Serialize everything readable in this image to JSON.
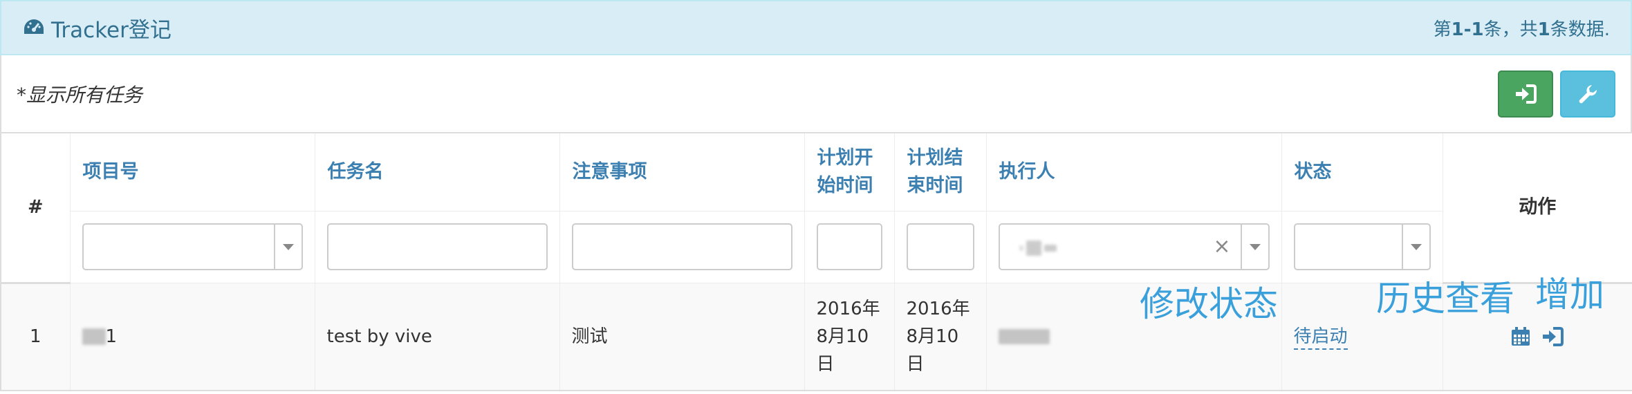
{
  "header": {
    "title": "Tracker登记",
    "summary_prefix": "第",
    "summary_range": "1-1",
    "summary_mid": "条，共",
    "summary_total": "1",
    "summary_suffix": "条数据."
  },
  "toolbar": {
    "filter_text": "*显示所有任务"
  },
  "table": {
    "columns": [
      "#",
      "项目号",
      "任务名",
      "注意事项",
      "计划开始时间",
      "计划结束时间",
      "执行人",
      "状态",
      "动作"
    ],
    "rows": [
      {
        "index": "1",
        "project_suffix": "1",
        "task_name": "test by vive",
        "notes": "测试",
        "plan_start": "2016年8月10日",
        "plan_end": "2016年8月10日",
        "status": "待启动"
      }
    ]
  },
  "annotations": {
    "modify_status": "修改状态",
    "history": "历史查看",
    "add": "增加"
  },
  "icons": {
    "title": "dashboard-icon",
    "export": "sign-in-icon",
    "settings": "wrench-icon",
    "calendar": "calendar-icon",
    "login": "sign-in-icon"
  },
  "colors": {
    "heading_bg": "#d9edf7",
    "heading_text": "#31708f",
    "link": "#3c7fb1",
    "success": "#4aa561",
    "info": "#5bc0de",
    "annotation": "#3aa0dc"
  }
}
